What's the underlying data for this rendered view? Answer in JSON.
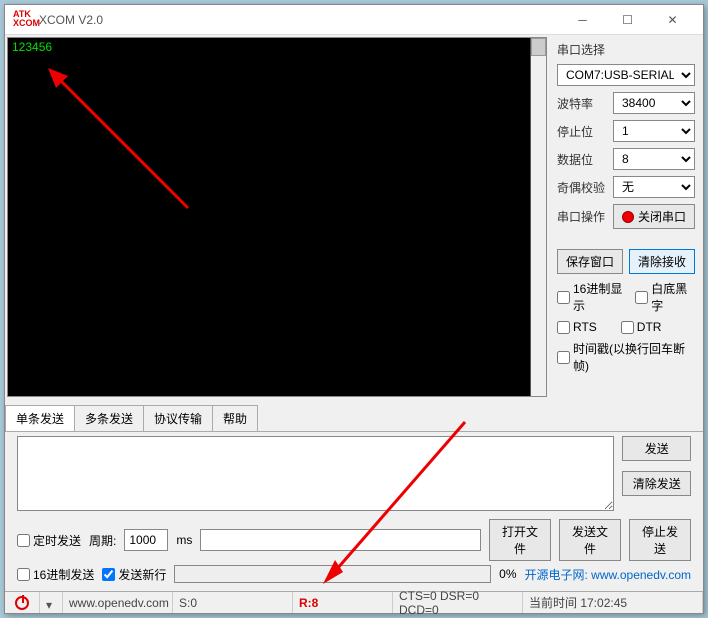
{
  "title": "XCOM V2.0",
  "terminal_output": "123456",
  "side": {
    "port_select_label": "串口选择",
    "port_value": "COM7:USB-SERIAL",
    "baud_label": "波特率",
    "baud_value": "38400",
    "stop_label": "停止位",
    "stop_value": "1",
    "data_label": "数据位",
    "data_value": "8",
    "parity_label": "奇偶校验",
    "parity_value": "无",
    "op_label": "串口操作",
    "close_label": "关闭串口",
    "save_window": "保存窗口",
    "clear_recv": "清除接收",
    "hex_display": "16进制显示",
    "white_black": "白底黑字",
    "rts": "RTS",
    "dtr": "DTR",
    "timestamp": "时间戳(以换行回车断帧)"
  },
  "tabs": {
    "t1": "单条发送",
    "t2": "多条发送",
    "t3": "协议传输",
    "t4": "帮助"
  },
  "bottom": {
    "timed_send": "定时发送",
    "period_label": "周期:",
    "period_value": "1000",
    "ms": "ms",
    "hex_send": "16进制发送",
    "send_newline": "发送新行",
    "open_file": "打开文件",
    "send_file": "发送文件",
    "stop_send": "停止发送",
    "progress_pct": "0%",
    "link_text1": "开源电子网:",
    "link_text2": "www.openedv.com",
    "send": "发送",
    "clear_send": "清除发送"
  },
  "status": {
    "url": "www.openedv.com",
    "s": "S:0",
    "r": "R:8",
    "cts": "CTS=0 DSR=0 DCD=0",
    "time_label": "当前时间 17:02:45"
  }
}
